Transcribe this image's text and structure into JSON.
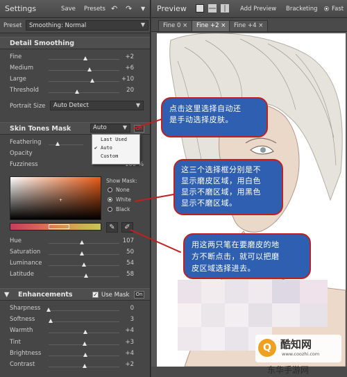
{
  "left_panel": {
    "title": "Settings",
    "save_label": "Save",
    "presets_label": "Presets",
    "undo_icon": "undo-icon",
    "redo_icon": "redo-icon",
    "menu_icon": "menu-icon",
    "preset_label": "Preset",
    "preset_value": "Smoothing: Normal",
    "detail_smoothing": {
      "title": "Detail Smoothing",
      "sliders": [
        {
          "label": "Fine",
          "value": "+2",
          "level": 0.52
        },
        {
          "label": "Medium",
          "value": "+6",
          "level": 0.58
        },
        {
          "label": "Large",
          "value": "+10",
          "level": 0.62
        },
        {
          "label": "Threshold",
          "value": "20",
          "level": 0.4
        }
      ],
      "portrait_size_label": "Portrait Size",
      "portrait_size_value": "Auto Detect"
    },
    "skin_tones_mask": {
      "title": "Skin Tones Mask",
      "mode_value": "Auto",
      "on_label": "On",
      "popup_items": [
        "Last Used",
        "Auto",
        "Custom"
      ],
      "popup_checked": "Auto",
      "sliders_top": [
        {
          "label": "Feathering",
          "value": ""
        },
        {
          "label": "Opacity",
          "value": ""
        },
        {
          "label": "Fuzziness",
          "value": "100 %"
        }
      ],
      "show_mask_label": "Show Mask:",
      "show_mask_options": [
        "None",
        "White",
        "Black"
      ],
      "show_mask_selected": "White",
      "sliders": [
        {
          "label": "Hue",
          "value": "107",
          "level": 0.47
        },
        {
          "label": "Saturation",
          "value": "50",
          "level": 0.47
        },
        {
          "label": "Luminance",
          "value": "54",
          "level": 0.5
        },
        {
          "label": "Latitude",
          "value": "58",
          "level": 0.53
        }
      ]
    },
    "enhancements": {
      "title": "Enhancements",
      "use_mask_label": "Use Mask",
      "on_label": "On",
      "sliders": [
        {
          "label": "Sharpness",
          "value": "0",
          "level": 0.0
        },
        {
          "label": "Softness",
          "value": "3",
          "level": 0.03
        },
        {
          "label": "Warmth",
          "value": "+4",
          "level": 0.52
        },
        {
          "label": "Tint",
          "value": "+3",
          "level": 0.51
        },
        {
          "label": "Brightness",
          "value": "+4",
          "level": 0.52
        },
        {
          "label": "Contrast",
          "value": "+2",
          "level": 0.51
        }
      ]
    }
  },
  "right_panel": {
    "title": "Preview",
    "add_preview_label": "Add Preview",
    "bracketing_label": "Bracketing",
    "fast_label": "Fast",
    "tabs": [
      "Fine 0",
      "Fine +2",
      "Fine +4"
    ],
    "active_tab": "Fine +2"
  },
  "annotations": {
    "callout1_line1": "点击这里选择自动还",
    "callout1_line2": "是手动选择皮肤。",
    "callout2_line1": "这三个选择框分别是不",
    "callout2_line2": "显示磨皮区域，用白色",
    "callout2_line3": "显示不磨区域，用黑色",
    "callout2_line4": "显示不磨区域。",
    "callout3_line1": "用这两只笔在要磨皮的地",
    "callout3_line2": "方不断点击，就可以把磨",
    "callout3_line3": "皮区域选择进去。",
    "color": "#c02020",
    "fill": "#2f5fb0"
  },
  "watermark": {
    "site_name": "酷知网",
    "site_url": "www.coozhi.com",
    "corner_text": "东华手游网"
  }
}
